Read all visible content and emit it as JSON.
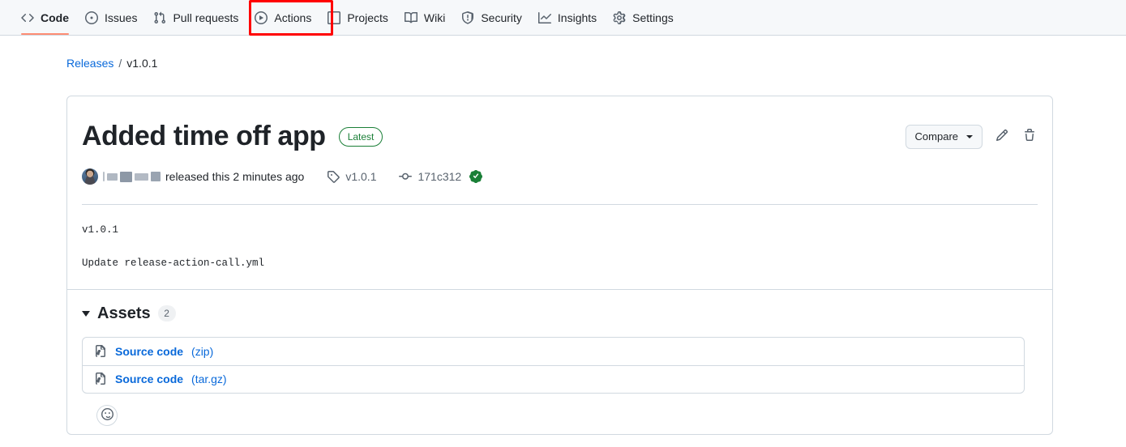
{
  "repo_nav": {
    "items": [
      {
        "label": "Code",
        "icon": "code-icon",
        "active": true
      },
      {
        "label": "Issues",
        "icon": "issue-opened-icon",
        "active": false
      },
      {
        "label": "Pull requests",
        "icon": "git-pull-request-icon",
        "active": false
      },
      {
        "label": "Actions",
        "icon": "play-icon",
        "active": false
      },
      {
        "label": "Projects",
        "icon": "table-icon",
        "active": false
      },
      {
        "label": "Wiki",
        "icon": "book-icon",
        "active": false
      },
      {
        "label": "Security",
        "icon": "shield-icon",
        "active": false
      },
      {
        "label": "Insights",
        "icon": "graph-icon",
        "active": false
      },
      {
        "label": "Settings",
        "icon": "gear-icon",
        "active": false
      }
    ]
  },
  "annotation": {
    "target": "Actions",
    "color": "#ff0000"
  },
  "breadcrumb": {
    "root_label": "Releases",
    "separator": "/",
    "current_label": "v1.0.1"
  },
  "release": {
    "title": "Added time off app",
    "latest_badge": "Latest",
    "compare_label": "Compare",
    "edit_icon": "pencil-icon",
    "delete_icon": "trash-icon",
    "author_name_redacted": true,
    "released_text": "released this",
    "released_time": "2 minutes ago",
    "tag_name": "v1.0.1",
    "commit_sha": "171c312",
    "verified_icon": "verified-check-icon",
    "body_lines": [
      "v1.0.1",
      "Update release-action-call.yml"
    ]
  },
  "assets": {
    "title": "Assets",
    "count": "2",
    "items": [
      {
        "name": "Source code",
        "ext": "(zip)"
      },
      {
        "name": "Source code",
        "ext": "(tar.gz)"
      }
    ]
  },
  "reactions": {
    "add_label": "smiley-icon"
  },
  "colors": {
    "link": "#0969da",
    "accent_underline": "#fd8c73",
    "success": "#1a7f37",
    "border": "#d1d9e0",
    "header_bg": "#f6f8fa"
  }
}
